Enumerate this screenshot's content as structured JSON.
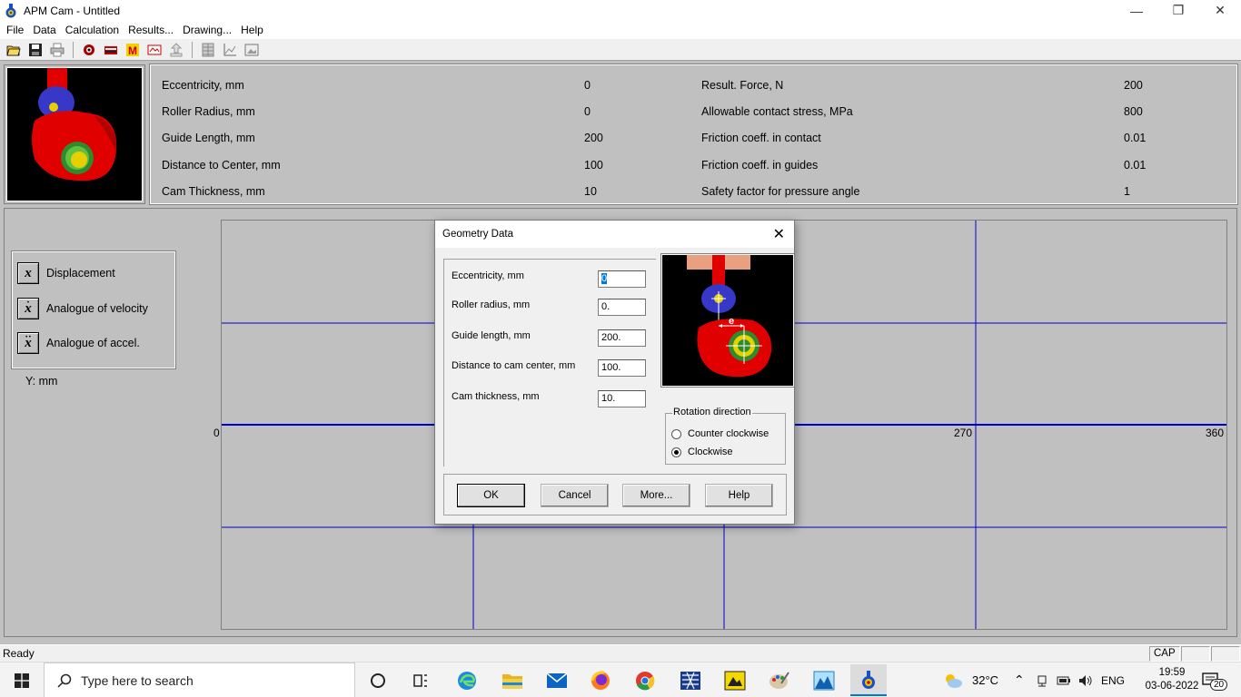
{
  "window": {
    "title": "APM Cam - Untitled",
    "minimize": "—",
    "maximize": "❐",
    "close": "✕"
  },
  "menu": [
    "File",
    "Data",
    "Calculation",
    "Results...",
    "Drawing...",
    "Help"
  ],
  "toolbar_icons": [
    "open-icon",
    "save-icon",
    "print-icon",
    "hazard-icon",
    "material-icon",
    "m-icon",
    "cam-icon",
    "export-icon",
    "table-icon",
    "graph-icon",
    "image-icon"
  ],
  "params": {
    "left": [
      {
        "label": "Eccentricity, mm",
        "value": "0"
      },
      {
        "label": "Roller Radius, mm",
        "value": "0"
      },
      {
        "label": "Guide Length, mm",
        "value": "200"
      },
      {
        "label": "Distance to Center, mm",
        "value": "100"
      },
      {
        "label": "Cam Thickness, mm",
        "value": "10"
      }
    ],
    "right": [
      {
        "label": "Result. Force, N",
        "value": "200"
      },
      {
        "label": "Allowable contact stress, MPa",
        "value": "800"
      },
      {
        "label": "Friction coeff. in contact",
        "value": "0.01"
      },
      {
        "label": "Friction coeff. in guides",
        "value": "0.01"
      },
      {
        "label": "Safety factor for pressure angle",
        "value": "1"
      }
    ]
  },
  "legend": {
    "items": [
      {
        "symbol": "x",
        "dots": "",
        "label": "Displacement"
      },
      {
        "symbol": "x",
        "dots": "·",
        "label": "Analogue of velocity"
      },
      {
        "symbol": "x",
        "dots": "··",
        "label": "Analogue of accel."
      }
    ],
    "y_label": "Y: mm"
  },
  "plot": {
    "x_ticks": [
      "0",
      "270",
      "360"
    ]
  },
  "dialog": {
    "title": "Geometry Data",
    "close": "✕",
    "fields": [
      {
        "label": "Eccentricity, mm",
        "value": "0"
      },
      {
        "label": "Roller radius, mm",
        "value": "0."
      },
      {
        "label": "Guide length, mm",
        "value": "200."
      },
      {
        "label": "Distance to cam center, mm",
        "value": "100."
      },
      {
        "label": "Cam thickness, mm",
        "value": "10."
      }
    ],
    "preview_label": "e",
    "rotation": {
      "title": "Rotation direction",
      "options": [
        "Counter clockwise",
        "Clockwise"
      ],
      "selected": "Clockwise"
    },
    "buttons": {
      "ok": "OK",
      "cancel": "Cancel",
      "more": "More...",
      "help": "Help"
    }
  },
  "status": {
    "text": "Ready",
    "cap": "CAP"
  },
  "taskbar": {
    "search_placeholder": "Type here to search",
    "weather": "32°C",
    "lang": "ENG",
    "time": "19:59",
    "date": "03-06-2022",
    "notifications": "20"
  }
}
